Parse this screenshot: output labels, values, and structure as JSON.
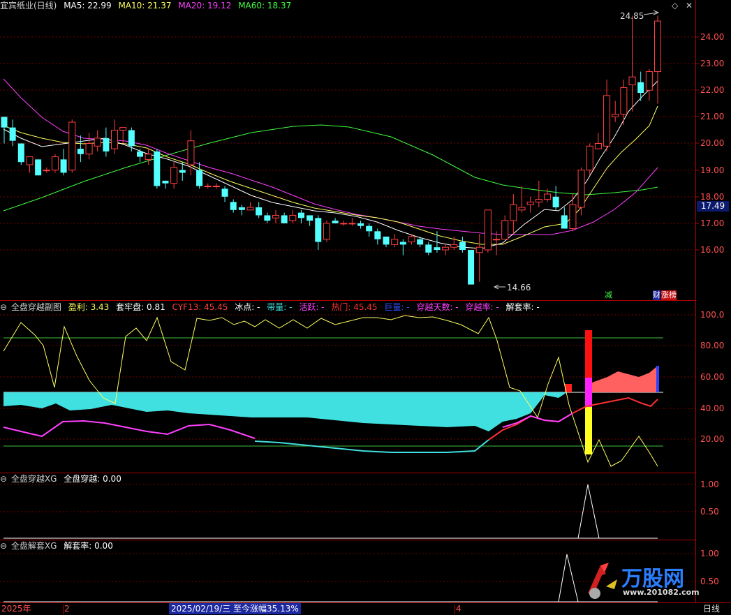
{
  "main_header": {
    "title": "宜宾纸业(日线)",
    "ma5": "MA5: 22.99",
    "ma10": "MA10: 21.37",
    "ma20": "MA20: 19.12",
    "ma60": "MA60: 18.37"
  },
  "sub1_header": {
    "name": "全盘穿越副图",
    "yingli": "盈利: 3.43",
    "taolao": "套牢盘: 0.81",
    "cyf13": "CYF13: 45.45",
    "bingdian": "冰点: -",
    "dailiang": "带量: -",
    "huoyue": "活跃: -",
    "remen": "热门: 45.45",
    "juliang": "巨量: -",
    "chuanyue_tianshu": "穿越天数: -",
    "chuanyue_lv": "穿越率: -",
    "jietao_lv": "解套率: -"
  },
  "sub2_header": {
    "name": "全盘穿越XG",
    "value": "全盘穿越: 0.00"
  },
  "sub3_header": {
    "name": "全盘解套XG",
    "value": "解套率: 0.00"
  },
  "price_axis": [
    "24.00",
    "23.00",
    "22.00",
    "21.00",
    "20.00",
    "19.00",
    "18.00",
    "17.00",
    "16.00"
  ],
  "current_price": "17.49",
  "max_label": "24.85",
  "min_label": "14.66",
  "sub1_axis": [
    "100.0",
    "80.00",
    "60.00",
    "40.00",
    "20.00"
  ],
  "sub2_axis": [
    "1.00",
    "0.50"
  ],
  "sub3_axis": [
    "1.00",
    "0.50"
  ],
  "tags": {
    "jian": "减",
    "cai": "财",
    "zhangbang": "涨榜"
  },
  "bottom": {
    "year": "2025年",
    "m2": "2",
    "status": "2025/02/19/三  至今涨幅35.13%",
    "m4": "4",
    "period": "日线"
  },
  "watermark": {
    "site": "万股网",
    "url": "www.201082.com"
  },
  "colors": {
    "up": "#ff4040",
    "down": "#54ffff",
    "ma5": "#ffffff",
    "ma10": "#ffff60",
    "ma20": "#ff40ff",
    "ma60": "#40ff40"
  },
  "chart_data": {
    "type": "candlestick",
    "ylim": [
      15.0,
      25.0
    ],
    "candles": [
      [
        21.0,
        20.6,
        21.0,
        20.0
      ],
      [
        20.6,
        20.1,
        20.9,
        19.9
      ],
      [
        20.0,
        19.3,
        20.0,
        19.2
      ],
      [
        19.2,
        19.5,
        19.5,
        18.9
      ],
      [
        19.4,
        18.8,
        19.4,
        18.8
      ],
      [
        19.0,
        19.0,
        19.1,
        18.9
      ],
      [
        19.0,
        19.5,
        19.6,
        18.9
      ],
      [
        19.4,
        18.9,
        19.8,
        18.8
      ],
      [
        19.0,
        20.8,
        20.9,
        18.9
      ],
      [
        19.8,
        19.6,
        20.3,
        19.3
      ],
      [
        19.6,
        20.0,
        20.4,
        19.4
      ],
      [
        19.9,
        20.2,
        20.5,
        19.7
      ],
      [
        20.2,
        19.7,
        20.6,
        19.5
      ],
      [
        19.8,
        20.5,
        20.9,
        19.6
      ],
      [
        20.5,
        20.6,
        20.6,
        20.0
      ],
      [
        20.5,
        19.9,
        20.6,
        19.7
      ],
      [
        19.7,
        19.5,
        19.8,
        19.3
      ],
      [
        19.4,
        19.6,
        19.8,
        19.2
      ],
      [
        19.7,
        18.4,
        19.8,
        18.3
      ],
      [
        18.6,
        18.5,
        18.6,
        18.3
      ],
      [
        18.5,
        19.1,
        19.3,
        18.3
      ],
      [
        19.0,
        18.9,
        19.3,
        18.6
      ],
      [
        19.2,
        20.1,
        20.5,
        18.8
      ],
      [
        19.0,
        18.4,
        19.3,
        18.3
      ],
      [
        18.4,
        18.4,
        18.5,
        18.3
      ],
      [
        18.4,
        18.4,
        18.5,
        18.3
      ],
      [
        18.3,
        18.0,
        18.4,
        17.8
      ],
      [
        17.8,
        17.5,
        17.9,
        17.4
      ],
      [
        17.6,
        17.5,
        17.7,
        17.3
      ],
      [
        17.5,
        17.6,
        17.8,
        17.5
      ],
      [
        17.6,
        17.3,
        17.8,
        17.2
      ],
      [
        17.3,
        17.1,
        17.4,
        17.0
      ],
      [
        17.2,
        17.3,
        17.5,
        17.0
      ],
      [
        17.3,
        17.0,
        17.4,
        17.0
      ],
      [
        17.1,
        17.3,
        17.5,
        17.0
      ],
      [
        17.4,
        17.2,
        17.5,
        17.0
      ],
      [
        17.3,
        17.1,
        17.3,
        16.9
      ],
      [
        17.2,
        16.3,
        17.3,
        16.0
      ],
      [
        16.4,
        17.0,
        17.1,
        16.3
      ],
      [
        17.1,
        17.0,
        17.2,
        17.0
      ],
      [
        17.0,
        17.0,
        17.1,
        16.9
      ],
      [
        17.0,
        17.0,
        17.2,
        16.9
      ],
      [
        17.0,
        16.9,
        17.1,
        16.8
      ],
      [
        16.9,
        16.7,
        17.0,
        16.5
      ],
      [
        16.7,
        16.4,
        16.8,
        16.2
      ],
      [
        16.5,
        16.2,
        16.5,
        16.1
      ],
      [
        16.2,
        16.4,
        16.6,
        16.1
      ],
      [
        16.3,
        16.2,
        16.4,
        15.8
      ],
      [
        16.3,
        16.5,
        16.6,
        16.2
      ],
      [
        16.4,
        16.2,
        16.5,
        16.1
      ],
      [
        16.2,
        15.9,
        16.3,
        15.8
      ],
      [
        16.1,
        16.0,
        16.7,
        15.9
      ],
      [
        16.0,
        16.1,
        16.2,
        15.8
      ],
      [
        16.1,
        16.2,
        16.5,
        16.0
      ],
      [
        16.3,
        16.0,
        16.5,
        15.9
      ],
      [
        16.0,
        14.7,
        16.0,
        14.7
      ],
      [
        15.9,
        16.1,
        16.6,
        14.8
      ],
      [
        16.0,
        17.5,
        17.5,
        15.9
      ],
      [
        16.4,
        16.4,
        16.7,
        15.8
      ],
      [
        16.4,
        17.1,
        17.3,
        16.4
      ],
      [
        17.1,
        17.7,
        18.1,
        16.6
      ],
      [
        17.5,
        17.6,
        18.4,
        17.4
      ],
      [
        17.7,
        17.8,
        18.0,
        17.4
      ],
      [
        17.8,
        17.9,
        18.6,
        17.6
      ],
      [
        17.9,
        18.1,
        18.3,
        17.8
      ],
      [
        18.0,
        17.6,
        18.4,
        17.5
      ],
      [
        17.3,
        16.8,
        17.6,
        16.8
      ],
      [
        16.8,
        17.7,
        18.1,
        16.7
      ],
      [
        17.6,
        19.0,
        19.1,
        17.3
      ],
      [
        19.0,
        19.9,
        20.0,
        18.8
      ],
      [
        19.8,
        20.0,
        20.4,
        19.8
      ],
      [
        19.9,
        21.8,
        22.4,
        19.7
      ],
      [
        21.0,
        21.1,
        21.6,
        20.8
      ],
      [
        21.1,
        22.1,
        22.4,
        20.7
      ],
      [
        22.2,
        22.5,
        24.8,
        21.2
      ],
      [
        22.3,
        21.9,
        22.7,
        21.6
      ],
      [
        22.0,
        22.7,
        22.8,
        21.6
      ],
      [
        22.7,
        24.6,
        24.8,
        21.5
      ]
    ]
  }
}
